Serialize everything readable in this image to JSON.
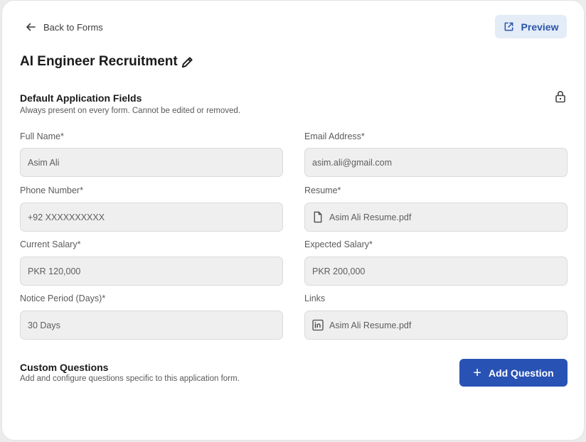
{
  "header": {
    "back_label": "Back to Forms",
    "preview_label": "Preview",
    "form_title": "AI Engineer Recruitment"
  },
  "default_fields": {
    "title": "Default Application Fields",
    "description": "Always present on every form. Cannot be edited or removed.",
    "fields": [
      {
        "label": "Full Name*",
        "value": "Asim Ali"
      },
      {
        "label": "Email Address*",
        "value": "asim.ali@gmail.com"
      },
      {
        "label": "Phone Number*",
        "value": "+92 XXXXXXXXXX"
      },
      {
        "label": "Resume*",
        "value": "Asim Ali Resume.pdf",
        "icon": "file-icon"
      },
      {
        "label": "Current Salary*",
        "value": "PKR 120,000"
      },
      {
        "label": "Expected Salary*",
        "value": "PKR 200,000"
      },
      {
        "label": "Notice Period (Days)*",
        "value": "30 Days"
      },
      {
        "label": "Links",
        "value": "Asim Ali Resume.pdf",
        "icon": "linkedin-icon"
      }
    ]
  },
  "custom_questions": {
    "title": "Custom Questions",
    "description": "Add and configure questions specific to this application form.",
    "add_label": "Add Question"
  },
  "colors": {
    "accent": "#2952b5",
    "preview_bg": "#e4ecf8",
    "field_bg": "#efefef"
  }
}
